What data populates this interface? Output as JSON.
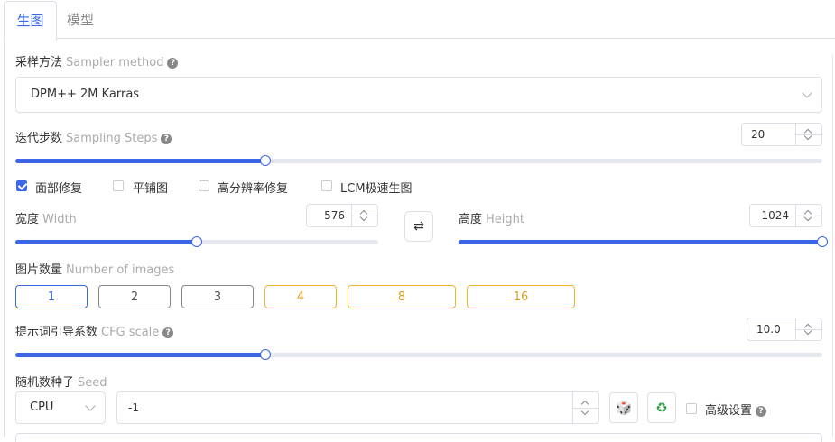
{
  "tabs": [
    {
      "label": "生图"
    },
    {
      "label": "模型"
    }
  ],
  "sampler": {
    "label": "采样方法",
    "label_en": "Sampler method",
    "value": "DPM++ 2M Karras"
  },
  "steps": {
    "label": "迭代步数",
    "label_en": "Sampling Steps",
    "value": "20",
    "fraction": 0.31
  },
  "options": [
    {
      "label": "面部修复",
      "checked": true
    },
    {
      "label": "平铺图",
      "checked": false
    },
    {
      "label": "高分辨率修复",
      "checked": false
    },
    {
      "label": "LCM极速生图",
      "checked": false
    }
  ],
  "width": {
    "label": "宽度",
    "label_en": "Width",
    "value": "576",
    "fraction": 0.5
  },
  "height": {
    "label": "高度",
    "label_en": "Height",
    "value": "1024",
    "fraction": 1.0
  },
  "swap_icon": "swap-arrows-icon",
  "images": {
    "label": "图片数量",
    "label_en": "Number of images",
    "choices": [
      "1",
      "2",
      "3",
      "4",
      "8",
      "16"
    ],
    "selected": "1"
  },
  "cfg": {
    "label": "提示词引导系数",
    "label_en": "CFG scale",
    "value": "10.0",
    "fraction": 0.31
  },
  "seed": {
    "label": "随机数种子",
    "label_en": "Seed",
    "device": "CPU",
    "value": "-1"
  },
  "advanced": {
    "label": "高级设置",
    "checked": false
  },
  "colors": {
    "accent": "#3b66e6",
    "gold": "#f0b429",
    "border": "#dcdfe6",
    "muted": "#aaaaaa"
  }
}
